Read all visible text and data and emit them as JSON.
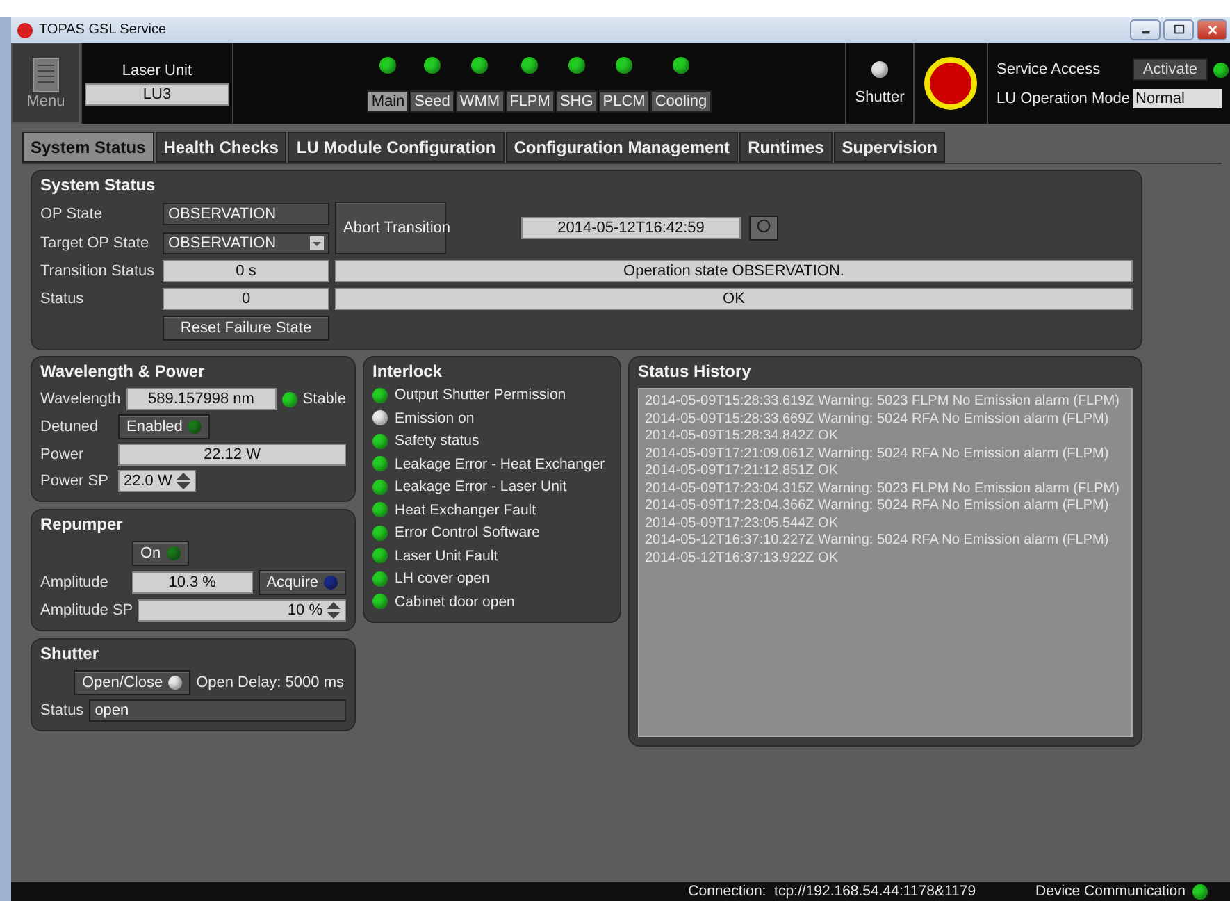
{
  "window": {
    "title": "TOPAS GSL Service"
  },
  "header": {
    "menu": "Menu",
    "laser_unit_label": "Laser Unit",
    "laser_unit": "LU3",
    "modules": [
      {
        "label": "Main",
        "selected": true,
        "color": "#22cc22"
      },
      {
        "label": "Seed",
        "selected": false,
        "color": "#22cc22"
      },
      {
        "label": "WMM",
        "selected": false,
        "color": "#22cc22"
      },
      {
        "label": "FLPM",
        "selected": false,
        "color": "#22cc22"
      },
      {
        "label": "SHG",
        "selected": false,
        "color": "#22cc22"
      },
      {
        "label": "PLCM",
        "selected": false,
        "color": "#22cc22"
      },
      {
        "label": "Cooling",
        "selected": false,
        "color": "#22cc22"
      }
    ],
    "shutter": {
      "label": "Shutter",
      "color": "#e0e0e0"
    },
    "service_access": "Service Access",
    "activate": {
      "label": "Activate",
      "color": "#22cc22"
    },
    "lu_mode_label": "LU Operation Mode",
    "lu_mode": "Normal"
  },
  "tabs": [
    {
      "label": "System Status",
      "selected": true
    },
    {
      "label": "Health Checks",
      "selected": false
    },
    {
      "label": "LU Module Configuration",
      "selected": false
    },
    {
      "label": "Configuration Management",
      "selected": false
    },
    {
      "label": "Runtimes",
      "selected": false
    },
    {
      "label": "Supervision",
      "selected": false
    }
  ],
  "system_status": {
    "title": "System Status",
    "op_state_label": "OP State",
    "op_state": "OBSERVATION",
    "target_label": "Target OP State",
    "target": "OBSERVATION",
    "abort": "Abort Transition",
    "timestamp": "2014-05-12T16:42:59",
    "transition_label": "Transition Status",
    "transition": "0 s",
    "transition_msg": "Operation state OBSERVATION.",
    "status_label": "Status",
    "status": "0",
    "status_msg": "OK",
    "reset": "Reset Failure State"
  },
  "wavelength_power": {
    "title": "Wavelength & Power",
    "wavelength_label": "Wavelength",
    "wavelength": "589.157998 nm",
    "stable": {
      "label": "Stable",
      "color": "#22cc22"
    },
    "detuned_label": "Detuned",
    "detuned": {
      "label": "Enabled",
      "color": "#1a7a1a"
    },
    "power_label": "Power",
    "power": "22.12 W",
    "power_sp_label": "Power SP",
    "power_sp": "22.0 W"
  },
  "repumper": {
    "title": "Repumper",
    "on": {
      "label": "On",
      "color": "#1a7a1a"
    },
    "amplitude_label": "Amplitude",
    "amplitude": "10.3 %",
    "acquire": {
      "label": "Acquire",
      "color": "#1a2a8a"
    },
    "amplitude_sp_label": "Amplitude SP",
    "amplitude_sp": "10 %"
  },
  "shutter": {
    "title": "Shutter",
    "open_close": {
      "label": "Open/Close",
      "color": "#e8e8e8"
    },
    "open_delay": "Open Delay: 5000 ms",
    "status_label": "Status",
    "status": "open"
  },
  "interlock": {
    "title": "Interlock",
    "items": [
      {
        "label": "Output Shutter Permission",
        "color": "#22cc22"
      },
      {
        "label": "Emission on",
        "color": "#e8e8e8"
      },
      {
        "label": "Safety status",
        "color": "#22cc22"
      },
      {
        "label": "Leakage Error - Heat Exchanger",
        "color": "#22cc22"
      },
      {
        "label": "Leakage Error - Laser Unit",
        "color": "#22cc22"
      },
      {
        "label": "Heat Exchanger Fault",
        "color": "#22cc22"
      },
      {
        "label": "Error Control Software",
        "color": "#22cc22"
      },
      {
        "label": "Laser Unit Fault",
        "color": "#22cc22"
      },
      {
        "label": "LH cover open",
        "color": "#22cc22"
      },
      {
        "label": "Cabinet door open",
        "color": "#22cc22"
      }
    ]
  },
  "status_history": {
    "title": "Status History",
    "lines": [
      "2014-05-09T15:28:33.619Z Warning: 5023 FLPM No Emission alarm (FLPM)",
      "2014-05-09T15:28:33.669Z Warning: 5024 RFA No Emission alarm (FLPM)",
      "2014-05-09T15:28:34.842Z OK",
      "2014-05-09T17:21:09.061Z Warning: 5024 RFA No Emission alarm (FLPM)",
      "2014-05-09T17:21:12.851Z OK",
      "2014-05-09T17:23:04.315Z Warning: 5023 FLPM No Emission alarm (FLPM)",
      "2014-05-09T17:23:04.366Z Warning: 5024 RFA No Emission alarm (FLPM)",
      "2014-05-09T17:23:05.544Z OK",
      "2014-05-12T16:37:10.227Z Warning: 5024 RFA No Emission alarm (FLPM)",
      "2014-05-12T16:37:13.922Z OK"
    ]
  },
  "status_bar": {
    "connection": "Connection:  tcp://192.168.54.44:1178&1179",
    "device_comm": {
      "label": "Device Communication",
      "color": "#22cc22"
    }
  }
}
